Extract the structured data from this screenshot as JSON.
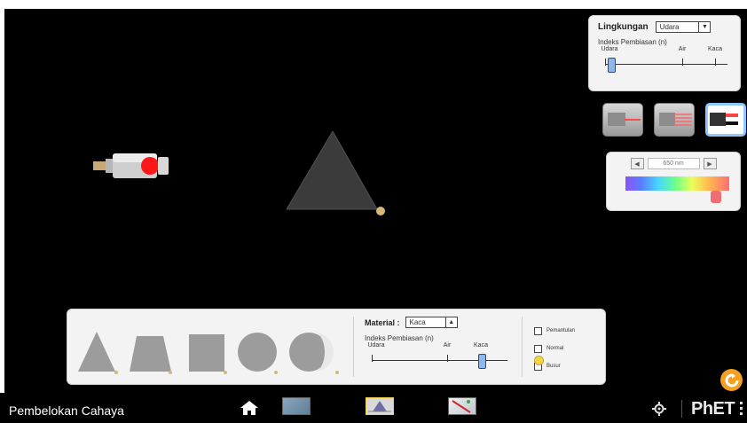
{
  "environment_panel": {
    "title": "Lingkungan",
    "dropdown_value": "Udara",
    "index_label": "Indeks Pembiasan (n)",
    "slider_labels": [
      "Udara",
      "Air",
      "Kaca"
    ]
  },
  "wave_panel": {
    "wavelength_value": "650 nm",
    "prev_symbol": "◀",
    "next_symbol": "▶"
  },
  "material_panel": {
    "title": "Material :",
    "dropdown_value": "Kaca",
    "index_label": "Indeks Pembiasan (n)",
    "slider_labels": [
      "Udara",
      "Air",
      "Kaca"
    ]
  },
  "checkboxes": [
    "Pemantulan",
    "Normal",
    "Busur"
  ],
  "bottom_bar": {
    "app_title": "Pembelokan Cahaya",
    "logo_text": "PhET"
  },
  "colors": {
    "background": "#000000",
    "panel": "#f3f3f3",
    "accent": "#f4a020",
    "highlight": "#8cc7ff",
    "shape": "#9c9c9c"
  },
  "icon_names": [
    "home-icon",
    "gear-icon",
    "reset-icon",
    "protractor-icon",
    "laser-icon"
  ]
}
